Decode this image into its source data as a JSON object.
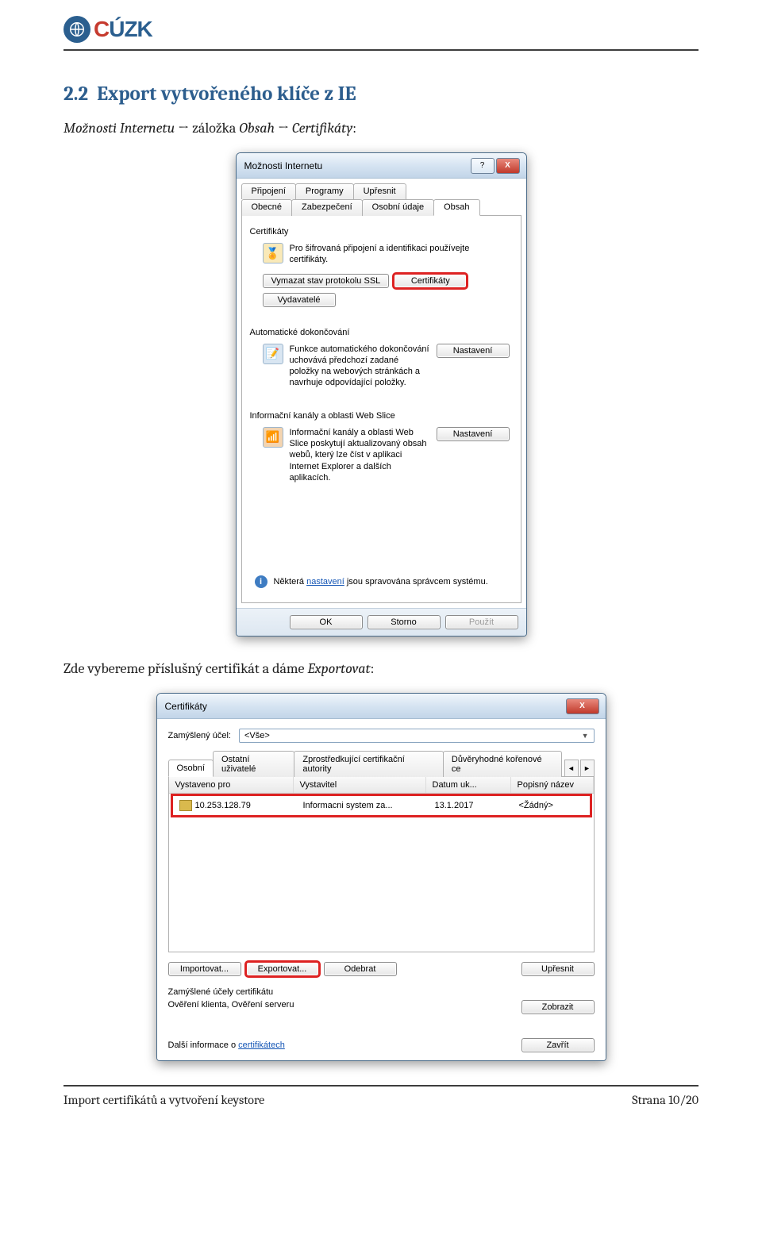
{
  "logo": {
    "c": "C",
    "uzk": "ÚZK"
  },
  "section_number": "2.2",
  "section_title": "Export vytvořeného klíče z IE",
  "intro_before": "Možnosti Internetu",
  "intro_arrow": " → ",
  "intro_mid": "záložka ",
  "intro_italic1": "Obsah",
  "intro_arrow2": " → ",
  "intro_italic2": "Certifikáty",
  "intro_colon": ":",
  "paragraph2_a": "Zde vybereme příslušný certifikát a dáme ",
  "paragraph2_b": "Exportovat",
  "paragraph2_c": ":",
  "dlg1": {
    "title": "Možnosti Internetu",
    "help": "?",
    "close": "X",
    "tabs_row1": [
      "Připojení",
      "Programy",
      "Upřesnit"
    ],
    "tabs_row2": [
      "Obecné",
      "Zabezpečení",
      "Osobní údaje",
      "Obsah"
    ],
    "grp_cert_label": "Certifikáty",
    "cert_desc": "Pro šifrovaná připojení a identifikaci používejte certifikáty.",
    "btn_ssl": "Vymazat stav protokolu SSL",
    "btn_cert": "Certifikáty",
    "btn_pub": "Vydavatelé",
    "grp_ac_label": "Automatické dokončování",
    "ac_desc": "Funkce automatického dokončování uchovává předchozí zadané položky na webových stránkách a navrhuje odpovídající položky.",
    "btn_settings": "Nastavení",
    "grp_feed_label": "Informační kanály a oblasti Web Slice",
    "feed_desc": "Informační kanály a oblasti Web Slice poskytují aktualizovaný obsah webů, který lze číst v aplikaci Internet Explorer a dalších aplikacích.",
    "btn_settings2": "Nastavení",
    "info_a": "Některá ",
    "info_link": "nastavení",
    "info_b": " jsou spravována správcem systému.",
    "btn_ok": "OK",
    "btn_cancel": "Storno",
    "btn_apply": "Použít"
  },
  "dlg2": {
    "title": "Certifikáty",
    "close": "X",
    "purpose_label": "Zamýšlený účel:",
    "purpose_value": "<Vše>",
    "tabs": [
      "Osobní",
      "Ostatní uživatelé",
      "Zprostředkující certifikační autority",
      "Důvěryhodné kořenové ce"
    ],
    "cols": [
      "Vystaveno pro",
      "Vystavitel",
      "Datum uk...",
      "Popisný název"
    ],
    "row": {
      "issued_to": "10.253.128.79",
      "issuer": "Informacni system za...",
      "date": "13.1.2017",
      "friendly": "<Žádný>"
    },
    "btn_import": "Importovat...",
    "btn_export": "Exportovat...",
    "btn_remove": "Odebrat",
    "btn_advanced": "Upřesnit",
    "purposes_label": "Zamýšlené účely certifikátu",
    "purposes_text": "Ověření klienta, Ověření serveru",
    "btn_view": "Zobrazit",
    "moreinfo_a": "Další informace o ",
    "moreinfo_link": "certifikátech",
    "btn_close": "Zavřít"
  },
  "footer_left": "Import certifikátů a vytvoření keystore",
  "footer_right": "Strana 10/20"
}
